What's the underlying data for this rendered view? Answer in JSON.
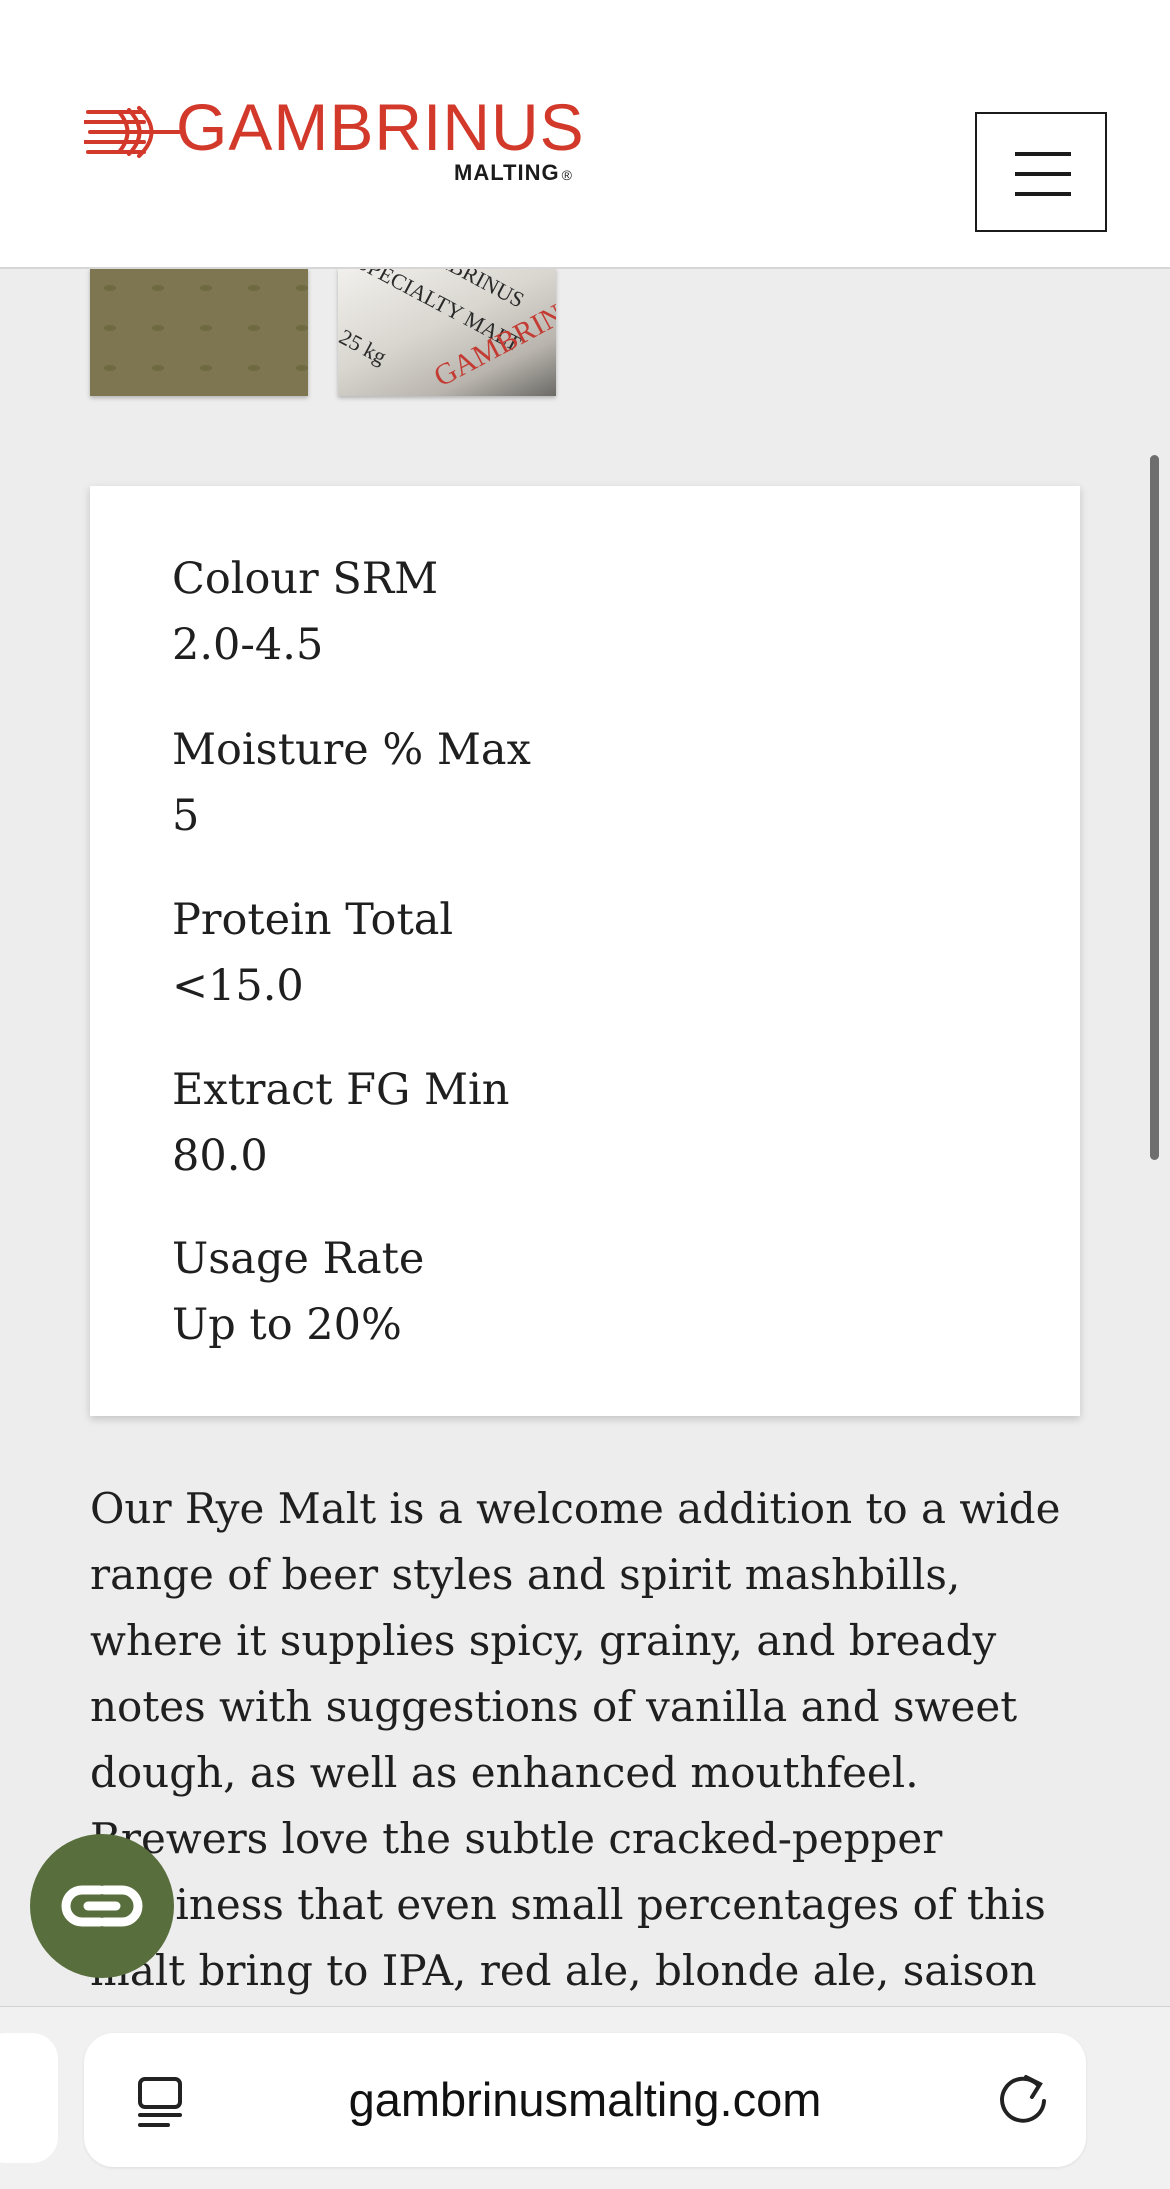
{
  "header": {
    "logo_word": "GAMBRINUS",
    "logo_sub": "MALTING",
    "logo_mark": "®",
    "brand_color": "#d2392b"
  },
  "thumbnails": [
    {
      "name": "grain-thumbnail"
    },
    {
      "name": "bag-thumbnail",
      "bag_lines": [
        "GAMBRINUS",
        "SPECIALTY MALT",
        "25 kg",
        "GAMBRINUS"
      ]
    }
  ],
  "specs": [
    {
      "label": "Colour SRM",
      "value": "2.0-4.5"
    },
    {
      "label": "Moisture % Max",
      "value": "5"
    },
    {
      "label": "Protein Total",
      "value": "<15.0"
    },
    {
      "label": "Extract FG Min",
      "value": "80.0"
    },
    {
      "label": "Usage Rate",
      "value": "Up to 20%"
    }
  ],
  "description": [
    "Our Rye Malt is a welcome addition to a wide",
    "range of beer styles and spirit mashbills,",
    "where it supplies spicy, grainy, and bready",
    "notes with suggestions of vanilla and sweet",
    "dough, as well as enhanced mouthfeel.",
    "Brewers love the subtle cracked-pepper",
    "spiciness that even small percentages of this",
    "malt bring to IPA, red ale, blonde ale, saison"
  ],
  "chat": {
    "icon": "chat-icon",
    "color": "#586e3d"
  },
  "browser": {
    "url": "gambrinusmalting.com",
    "tabs_icon": "tabs-icon",
    "reload_icon": "reload-icon"
  }
}
